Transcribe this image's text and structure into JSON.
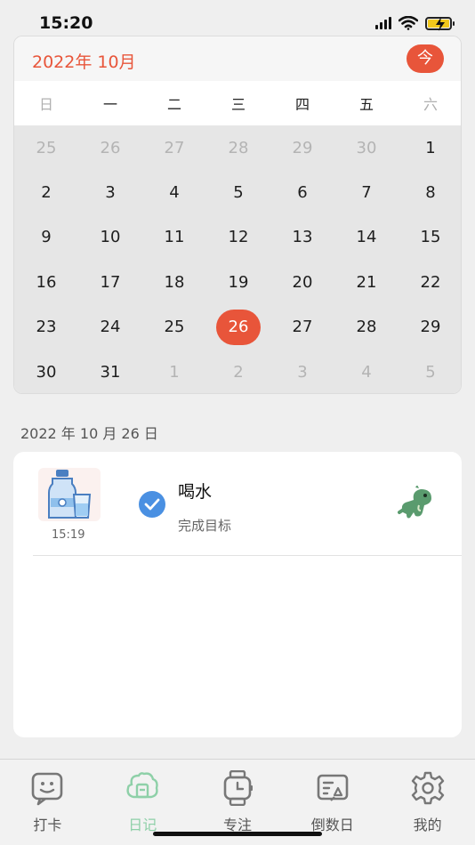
{
  "status_bar": {
    "time": "15:20"
  },
  "calendar": {
    "month_title": "2022年 10月",
    "today_label": "今",
    "weekdays": [
      "日",
      "一",
      "二",
      "三",
      "四",
      "五",
      "六"
    ],
    "selected_day": "26",
    "days": [
      {
        "d": "25",
        "outside": true
      },
      {
        "d": "26",
        "outside": true
      },
      {
        "d": "27",
        "outside": true
      },
      {
        "d": "28",
        "outside": true
      },
      {
        "d": "29",
        "outside": true
      },
      {
        "d": "30",
        "outside": true
      },
      {
        "d": "1",
        "outside": false
      },
      {
        "d": "2",
        "outside": false
      },
      {
        "d": "3",
        "outside": false
      },
      {
        "d": "4",
        "outside": false
      },
      {
        "d": "5",
        "outside": false
      },
      {
        "d": "6",
        "outside": false
      },
      {
        "d": "7",
        "outside": false
      },
      {
        "d": "8",
        "outside": false
      },
      {
        "d": "9",
        "outside": false
      },
      {
        "d": "10",
        "outside": false
      },
      {
        "d": "11",
        "outside": false
      },
      {
        "d": "12",
        "outside": false
      },
      {
        "d": "13",
        "outside": false
      },
      {
        "d": "14",
        "outside": false
      },
      {
        "d": "15",
        "outside": false
      },
      {
        "d": "16",
        "outside": false
      },
      {
        "d": "17",
        "outside": false
      },
      {
        "d": "18",
        "outside": false
      },
      {
        "d": "19",
        "outside": false
      },
      {
        "d": "20",
        "outside": false
      },
      {
        "d": "21",
        "outside": false
      },
      {
        "d": "22",
        "outside": false
      },
      {
        "d": "23",
        "outside": false
      },
      {
        "d": "24",
        "outside": false
      },
      {
        "d": "25",
        "outside": false
      },
      {
        "d": "26",
        "outside": false
      },
      {
        "d": "27",
        "outside": false
      },
      {
        "d": "28",
        "outside": false
      },
      {
        "d": "29",
        "outside": false
      },
      {
        "d": "30",
        "outside": false
      },
      {
        "d": "31",
        "outside": false
      },
      {
        "d": "1",
        "outside": true
      },
      {
        "d": "2",
        "outside": true
      },
      {
        "d": "3",
        "outside": true
      },
      {
        "d": "4",
        "outside": true
      },
      {
        "d": "5",
        "outside": true
      }
    ]
  },
  "selected_date_label": "2022 年 10 月 26 日",
  "entry": {
    "time": "15:19",
    "title": "喝水",
    "subtitle": "完成目标",
    "icon": "water-bottle-icon",
    "check_color": "#4a90e2"
  },
  "tabs": [
    {
      "label": "打卡",
      "icon": "checkin-face-icon",
      "active": false
    },
    {
      "label": "日记",
      "icon": "diary-icon",
      "active": true
    },
    {
      "label": "专注",
      "icon": "focus-watch-icon",
      "active": false
    },
    {
      "label": "倒数日",
      "icon": "countdown-icon",
      "active": false
    },
    {
      "label": "我的",
      "icon": "gear-icon",
      "active": false
    }
  ],
  "colors": {
    "accent": "#e8553a",
    "active_tab": "#8ed0a8"
  }
}
